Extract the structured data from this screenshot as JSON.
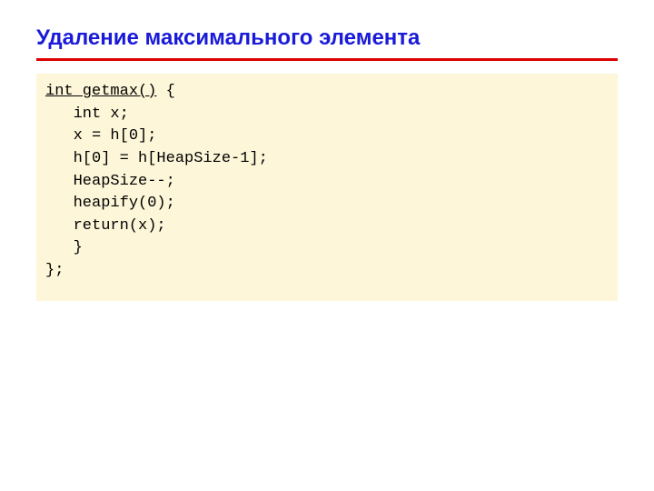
{
  "slide": {
    "title": "Удаление максимального элемента",
    "code": {
      "line1_sig": "int getmax()",
      "line1_rest": " {",
      "line2": "   int x;",
      "line3": "   x = h[0];",
      "line4": "   h[0] = h[HeapSize-1];",
      "line5": "   HeapSize--;",
      "line6": "   heapify(0);",
      "line7": "   return(x);",
      "line8": "   }",
      "line9": "};"
    }
  }
}
